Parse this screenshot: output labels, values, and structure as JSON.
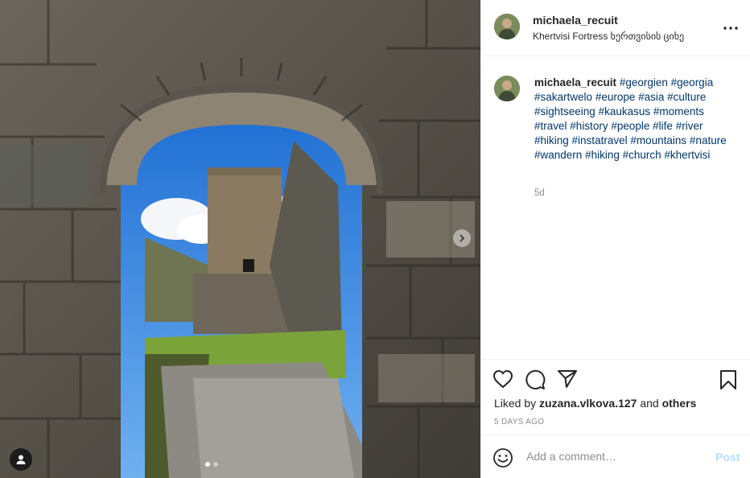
{
  "post": {
    "username": "michaela_recuit",
    "location": "Khertvisi Fortress ხერთვისის ციხე"
  },
  "caption": {
    "username": "michaela_recuit",
    "hashtags": [
      "#georgien",
      "#georgia",
      "#sakartwelo",
      "#europe",
      "#asia",
      "#culture",
      "#sightseeing",
      "#kaukasus",
      "#moments",
      "#travel",
      "#history",
      "#people",
      "#life",
      "#river",
      "#hiking",
      "#instatravel",
      "#mountains",
      "#nature",
      "#wandern",
      "#hiking",
      "#church",
      "#khertvisi"
    ],
    "time": "5d"
  },
  "likes": {
    "prefix": "Liked by",
    "user": "zuzana.vlkova.127",
    "conj": "and",
    "others": "others"
  },
  "posted_ago": "5 DAYS AGO",
  "comment": {
    "placeholder": "Add a comment…",
    "post_label": "Post"
  },
  "carousel": {
    "total": 2,
    "active": 0
  },
  "colors": {
    "hashtag": "#00376b",
    "muted": "#8e8e8e",
    "post_disabled": "#b2dffc"
  },
  "icons": [
    "user-tag-icon",
    "chevron-right-icon",
    "more-options-icon",
    "heart-icon",
    "comment-icon",
    "share-icon",
    "bookmark-icon",
    "emoji-icon"
  ]
}
